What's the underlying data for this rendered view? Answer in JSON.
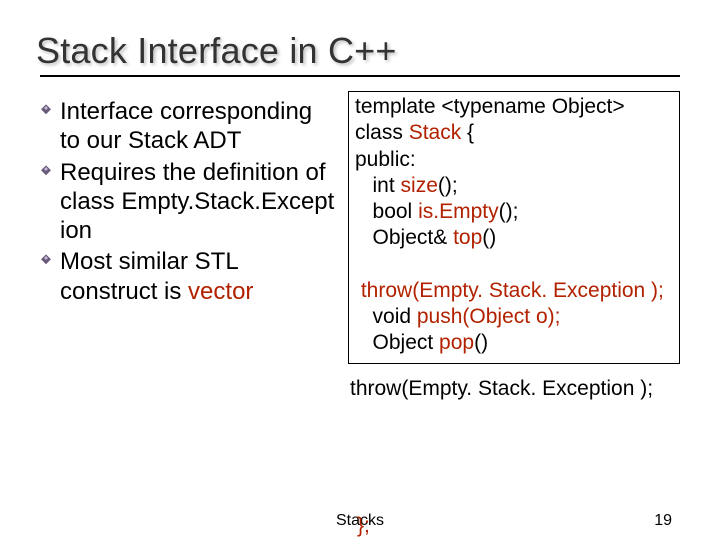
{
  "title": "Stack Interface in C++",
  "bullets": {
    "b1": "Interface corresponding to our Stack ADT",
    "b2": "Requires the definition of class Empty.Stack.Except ion",
    "b3_prefix": "Most similar STL construct is ",
    "b3_vec": "vector"
  },
  "code": {
    "l1": "template <typename Object>",
    "l2_a": "class ",
    "l2_b": "Stack",
    "l2_c": " {",
    "l3": "public:",
    "l4_a": "   int ",
    "l4_b": "size",
    "l4_c": "();",
    "l5_a": "   bool ",
    "l5_b": "is.Empty",
    "l5_c": "();",
    "l6_a": "   Object& ",
    "l6_b": "top",
    "l6_c": "()",
    "l7": " throw(Empty. Stack. Exception );",
    "l8_a": "   void ",
    "l8_b": "push",
    "l8_c": "(Object o);",
    "l9_a": "   Object ",
    "l9_b": "pop",
    "l9_c": "()"
  },
  "below": {
    "throw": "throw(Empty. Stack. Exception );",
    "brace": "};"
  },
  "footer": {
    "center": "Stacks",
    "page": "19"
  }
}
